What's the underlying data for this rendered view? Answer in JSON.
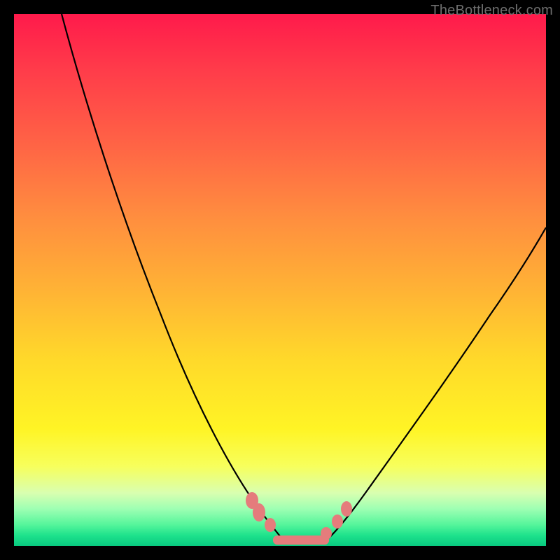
{
  "watermark": "TheBottleneck.com",
  "colors": {
    "frame": "#000000",
    "gradient_top": "#ff1a4b",
    "gradient_bottom": "#08c97f",
    "curve": "#000000",
    "blob": "#e57c7c"
  },
  "chart_data": {
    "type": "line",
    "title": "",
    "xlabel": "",
    "ylabel": "",
    "xlim": [
      0,
      100
    ],
    "ylim": [
      0,
      100
    ],
    "grid": false,
    "legend": false,
    "series": [
      {
        "name": "left-curve",
        "x": [
          10,
          15,
          20,
          25,
          30,
          35,
          40,
          45,
          48,
          50
        ],
        "y": [
          100,
          80,
          62,
          46,
          32,
          20,
          10,
          4,
          1,
          0
        ]
      },
      {
        "name": "right-curve",
        "x": [
          58,
          62,
          68,
          75,
          82,
          90,
          100
        ],
        "y": [
          0,
          3,
          10,
          20,
          32,
          45,
          60
        ]
      }
    ],
    "annotations": [
      {
        "name": "bottom-blob-cluster",
        "type": "marker-cluster",
        "x_range": [
          44,
          62
        ],
        "y_range": [
          0,
          6
        ],
        "color": "#e57c7c"
      }
    ]
  }
}
